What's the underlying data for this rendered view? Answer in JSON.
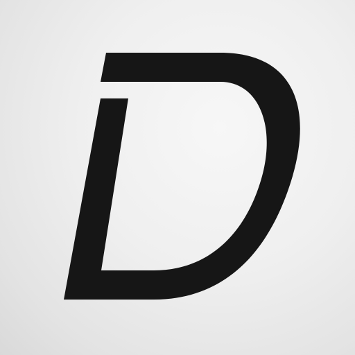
{
  "logo": {
    "lettering": "D",
    "icon": "letter-d-logo-icon",
    "glyph_color": "#161616",
    "background_color": "#efefef"
  }
}
